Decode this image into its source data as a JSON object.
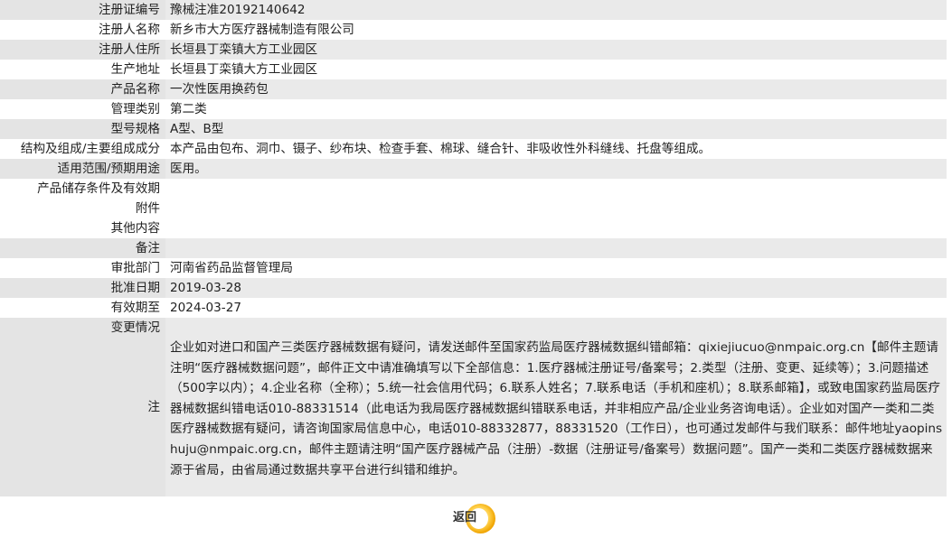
{
  "rows": [
    {
      "label": "注册证编号",
      "value": "豫械注准20192140642"
    },
    {
      "label": "注册人名称",
      "value": "新乡市大方医疗器械制造有限公司"
    },
    {
      "label": "注册人住所",
      "value": "长垣县丁栾镇大方工业园区"
    },
    {
      "label": "生产地址",
      "value": "长垣县丁栾镇大方工业园区"
    },
    {
      "label": "产品名称",
      "value": "一次性医用换药包"
    },
    {
      "label": "管理类别",
      "value": "第二类"
    },
    {
      "label": "型号规格",
      "value": "A型、B型"
    },
    {
      "label": "结构及组成/主要组成成分",
      "value": "本产品由包布、洞巾、镊子、纱布块、检查手套、棉球、缝合针、非吸收性外科缝线、托盘等组成。"
    },
    {
      "label": "适用范围/预期用途",
      "value": "医用。"
    },
    {
      "label": "产品储存条件及有效期",
      "value": ""
    },
    {
      "label": "附件",
      "value": ""
    },
    {
      "label": "其他内容",
      "value": ""
    },
    {
      "label": "备注",
      "value": ""
    },
    {
      "label": "审批部门",
      "value": "河南省药品监督管理局"
    },
    {
      "label": "批准日期",
      "value": "2019-03-28"
    },
    {
      "label": "有效期至",
      "value": "2024-03-27"
    }
  ],
  "change": {
    "label": "变更情况"
  },
  "note": {
    "label": "注",
    "text": "企业如对进口和国产三类医疗器械数据有疑问，请发送邮件至国家药监局医疗器械数据纠错邮箱：qixiejiucuo@nmpaic.org.cn【邮件主题请注明“医疗器械数据问题”，邮件正文中请准确填写以下全部信息：1.医疗器械注册证号/备案号；2.类型（注册、变更、延续等）；3.问题描述（500字以内）；4.企业名称（全称）；5.统一社会信用代码；6.联系人姓名；7.联系电话（手机和座机）；8.联系邮箱】，或致电国家药监局医疗器械数据纠错电话010-88331514（此电话为我局医疗器械数据纠错联系电话，并非相应产品/企业业务咨询电话）。企业如对国产一类和二类医疗器械数据有疑问，请咨询国家局信息中心，电话010-88332877，88331520（工作日），也可通过发邮件与我们联系：邮件地址yaopinshuju@nmpaic.org.cn，邮件主题请注明“国产医疗器械产品（注册）-数据（注册证号/备案号）数据问题”。国产一类和二类医疗器械数据来源于省局，由省局通过数据共享平台进行纠错和维护。"
  },
  "back_button": {
    "label": "返回",
    "icon": "circle-ring-icon"
  }
}
